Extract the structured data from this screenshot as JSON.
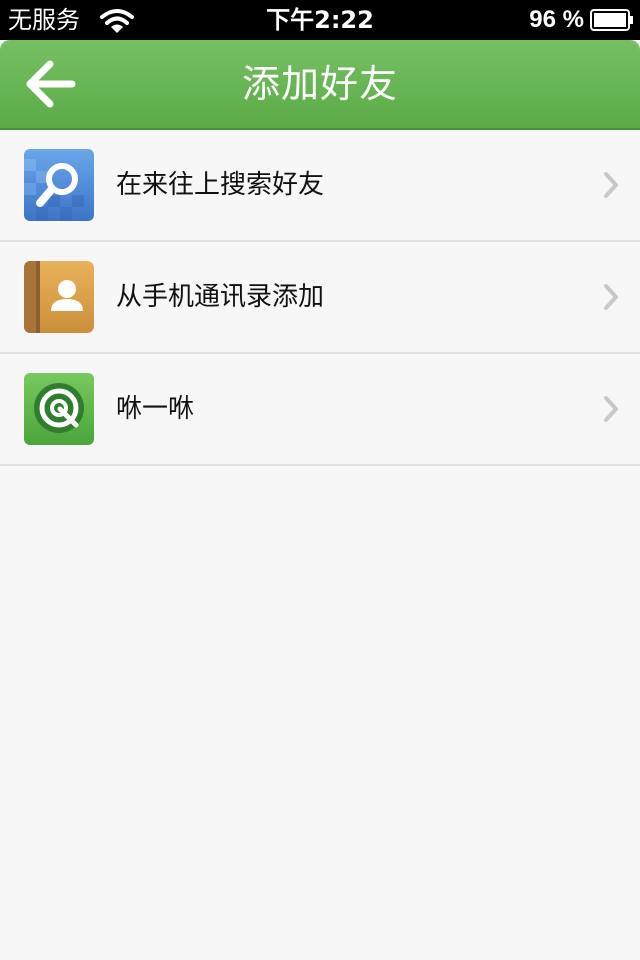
{
  "status_bar": {
    "carrier": "无服务",
    "time": "下午2:22",
    "battery": "96 %"
  },
  "header": {
    "title": "添加好友",
    "back_icon": "arrow-left-icon"
  },
  "menu": {
    "items": [
      {
        "label": "在来往上搜索好友",
        "icon": "search-icon",
        "color": "#4a86d8"
      },
      {
        "label": "从手机通讯录添加",
        "icon": "contacts-book-icon",
        "color": "#d9a24e"
      },
      {
        "label": "咻一咻",
        "icon": "radar-icon",
        "color": "#5bb84a"
      }
    ]
  },
  "colors": {
    "nav_green": "#68b654",
    "background": "#f7f7f7"
  }
}
